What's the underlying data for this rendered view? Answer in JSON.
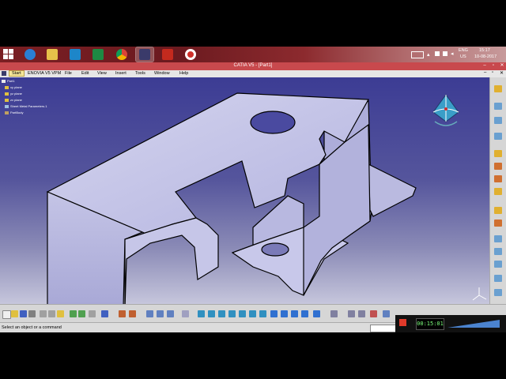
{
  "taskbar": {
    "apps": [
      {
        "name": "internet-explorer",
        "color": "#2a7fd4"
      },
      {
        "name": "file-explorer",
        "color": "#e6c24a"
      },
      {
        "name": "app-blue",
        "color": "#1d86c9"
      },
      {
        "name": "excel",
        "color": "#1e8a43"
      },
      {
        "name": "chrome",
        "color": "#e0b13a"
      },
      {
        "name": "catia",
        "color": "#3a3a6a"
      },
      {
        "name": "acrobat",
        "color": "#c42a1e"
      },
      {
        "name": "recorder",
        "color": "#d0302a"
      }
    ],
    "tray": {
      "lang": "ENG",
      "region": "US",
      "time": "15:17",
      "date": "10-08-2017"
    }
  },
  "window": {
    "title": "CATIA V5 - [Part1]",
    "menu": [
      "Start",
      "ENOVIA V5 VPM",
      "File",
      "Edit",
      "View",
      "Insert",
      "Tools",
      "Window",
      "Help"
    ]
  },
  "tree": {
    "items": [
      "Part1",
      "xy plane",
      "yz plane",
      "zx plane",
      "Sheet Metal Parameters.1",
      "PartBody"
    ]
  },
  "status": {
    "message": "Select an object or a command"
  },
  "recorder": {
    "time": "00:15:01"
  },
  "colors": {
    "accent": "#c8494d",
    "part_fill": "#b9b9e2",
    "viewport_top": "#3c3c94",
    "viewport_bottom": "#c6c6dc"
  }
}
